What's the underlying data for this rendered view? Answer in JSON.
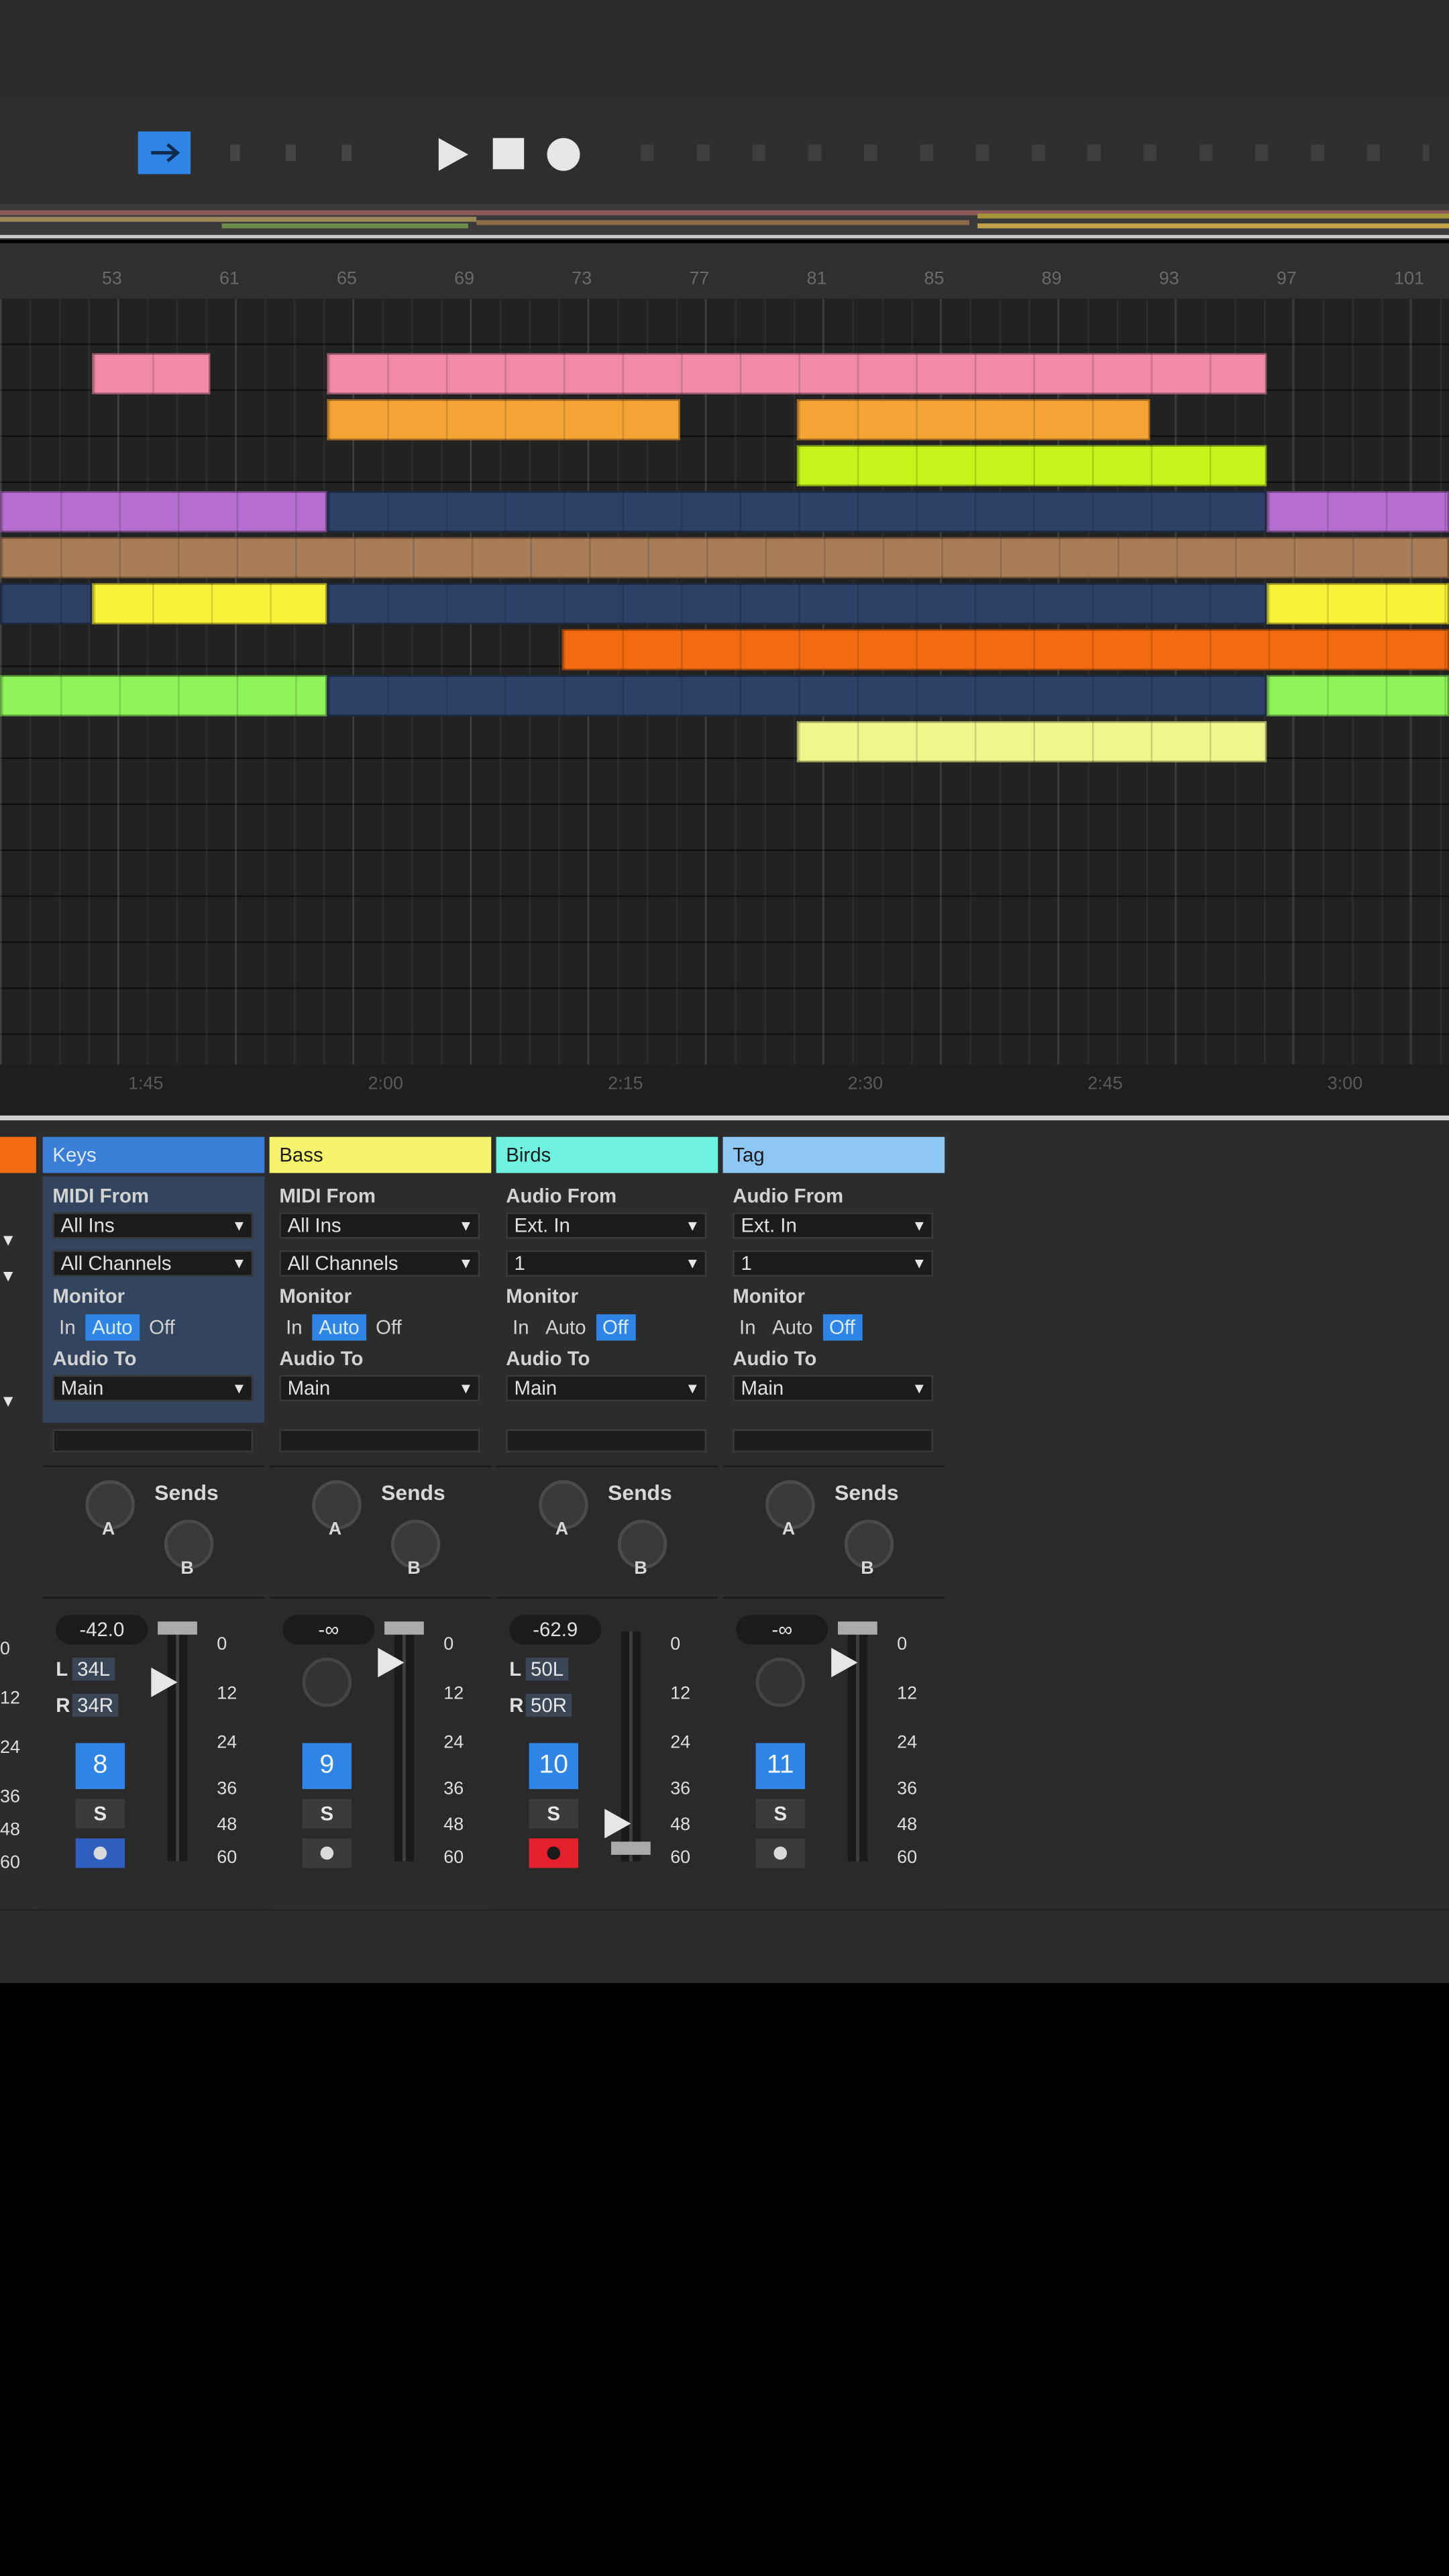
{
  "colors": {
    "bg": "#000000",
    "panel": "#2c2c2c",
    "accent": "#2e85e6",
    "pink": "#f08aa8",
    "orange_light": "#f4a335",
    "lime": "#c6f51c",
    "purple": "#b56ed0",
    "navy": "#2d4066",
    "brown": "#a87d58",
    "yellow": "#f8f239",
    "orange": "#f26b10",
    "green": "#8ff45a",
    "pale_yellow": "#eef68c"
  },
  "transport": {
    "icons": [
      "arrangement-view-icon",
      "play-icon",
      "stop-icon",
      "record-icon"
    ]
  },
  "ruler": {
    "ticks": [
      "53",
      "61",
      "65",
      "69",
      "73",
      "77",
      "81",
      "85",
      "89",
      "93",
      "97",
      "101"
    ]
  },
  "timebar": {
    "labels": [
      "1:45",
      "2:00",
      "2:15",
      "2:30",
      "2:45",
      "3:00"
    ]
  },
  "arrangement": {
    "rows": [
      {
        "clips": [
          {
            "color": "pink",
            "from": 0.5,
            "to": 1.5
          },
          {
            "color": "pink",
            "from": 2.5,
            "to": 10.5
          }
        ]
      },
      {
        "clips": [
          {
            "color": "orange_light",
            "from": 2.5,
            "to": 5.5
          },
          {
            "color": "orange_light",
            "from": 6.5,
            "to": 9.5
          }
        ]
      },
      {
        "clips": [
          {
            "color": "lime",
            "from": 6.5,
            "to": 10.5
          }
        ]
      },
      {
        "clips": [
          {
            "color": "purple",
            "from": -0.5,
            "to": 2.5
          },
          {
            "color": "navy",
            "from": 2.5,
            "to": 10.5
          },
          {
            "color": "purple",
            "from": 10.5,
            "to": 12.5
          }
        ]
      },
      {
        "clips": [
          {
            "color": "brown",
            "from": -0.5,
            "to": 12.5
          }
        ]
      },
      {
        "clips": [
          {
            "color": "navy",
            "from": -0.5,
            "to": 0.5
          },
          {
            "color": "yellow",
            "from": 0.5,
            "to": 2.5
          },
          {
            "color": "navy",
            "from": 2.5,
            "to": 10.5
          },
          {
            "color": "yellow",
            "from": 10.5,
            "to": 12.5
          }
        ]
      },
      {
        "clips": [
          {
            "color": "orange",
            "from": 4.5,
            "to": 12.5
          }
        ]
      },
      {
        "clips": [
          {
            "color": "green",
            "from": -0.5,
            "to": 2.5
          },
          {
            "color": "navy",
            "from": 2.5,
            "to": 10.5
          },
          {
            "color": "green",
            "from": 10.5,
            "to": 12.5
          }
        ]
      },
      {
        "clips": [
          {
            "color": "pale_yellow",
            "from": 6.5,
            "to": 10.5
          }
        ]
      }
    ]
  },
  "mixer": {
    "partial_track": {
      "scale": [
        "0",
        "12",
        "24",
        "36",
        "48",
        "60"
      ],
      "color": "#f26b10"
    },
    "tracks": [
      {
        "name": "Keys",
        "color": "#3a7ed8",
        "bottom_color": "#8ff45a",
        "selected": true,
        "from_label": "MIDI From",
        "from_value": "All Ins",
        "channel_value": "All Channels",
        "monitor_label": "Monitor",
        "monitor": [
          "In",
          "Auto",
          "Off"
        ],
        "monitor_active": 1,
        "audio_to_label": "Audio To",
        "audio_to_value": "Main",
        "sends_label": "Sends",
        "send_a": "A",
        "send_b": "B",
        "volume": "-42.0",
        "pan_l": "34L",
        "pan_r": "34R",
        "track_number": "8",
        "solo": "S",
        "arm": "monitor",
        "play_at": 1,
        "scale": [
          "0",
          "12",
          "24",
          "36",
          "48",
          "60"
        ]
      },
      {
        "name": "Bass",
        "color": "#f6f36d",
        "bottom_color": "#f8f239",
        "selected": false,
        "from_label": "MIDI From",
        "from_value": "All Ins",
        "channel_value": "All Channels",
        "monitor_label": "Monitor",
        "monitor": [
          "In",
          "Auto",
          "Off"
        ],
        "monitor_active": 1,
        "audio_to_label": "Audio To",
        "audio_to_value": "Main",
        "sends_label": "Sends",
        "send_a": "A",
        "send_b": "B",
        "volume": "-∞",
        "pan_l": "",
        "pan_r": "",
        "track_number": "9",
        "solo": "S",
        "arm": "off",
        "play_at": 0,
        "scale": [
          "0",
          "12",
          "24",
          "36",
          "48",
          "60"
        ]
      },
      {
        "name": "Birds",
        "color": "#6ff2df",
        "bottom_color": "#59e8d8",
        "selected": false,
        "from_label": "Audio From",
        "from_value": "Ext. In",
        "channel_value": "1",
        "monitor_label": "Monitor",
        "monitor": [
          "In",
          "Auto",
          "Off"
        ],
        "monitor_active": 2,
        "audio_to_label": "Audio To",
        "audio_to_value": "Main",
        "sends_label": "Sends",
        "send_a": "A",
        "send_b": "B",
        "volume": "-62.9",
        "pan_l": "50L",
        "pan_r": "50R",
        "track_number": "10",
        "solo": "S",
        "arm": "rec",
        "play_at": 3,
        "scale": [
          "0",
          "12",
          "24",
          "36",
          "48",
          "60"
        ]
      },
      {
        "name": "Tag",
        "color": "#8ec6f4",
        "bottom_color": "#8ec6f4",
        "selected": false,
        "from_label": "Audio From",
        "from_value": "Ext. In",
        "channel_value": "1",
        "monitor_label": "Monitor",
        "monitor": [
          "In",
          "Auto",
          "Off"
        ],
        "monitor_active": 2,
        "audio_to_label": "Audio To",
        "audio_to_value": "Main",
        "sends_label": "Sends",
        "send_a": "A",
        "send_b": "B",
        "volume": "-∞",
        "pan_l": "",
        "pan_r": "",
        "track_number": "11",
        "solo": "S",
        "arm": "off",
        "play_at": 0,
        "scale": [
          "0",
          "12",
          "24",
          "36",
          "48",
          "60"
        ]
      }
    ]
  }
}
